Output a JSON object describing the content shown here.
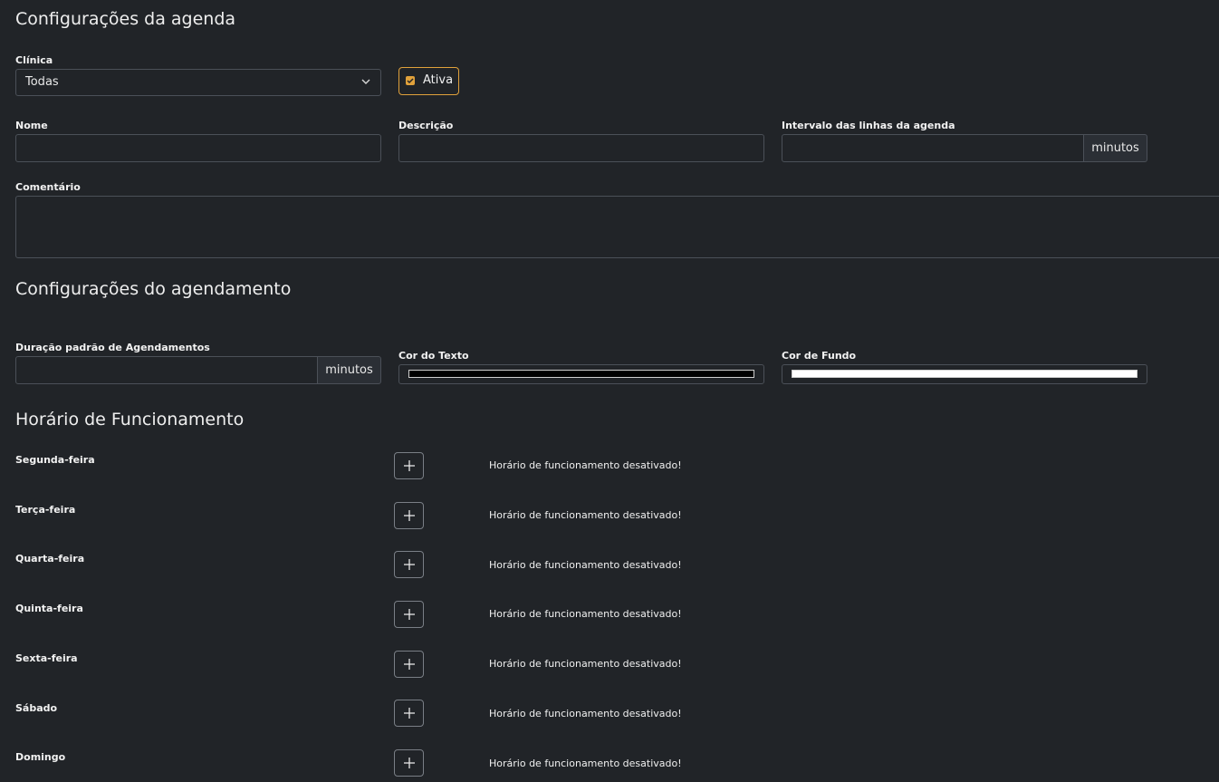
{
  "agenda": {
    "title": "Configurações da agenda",
    "clinic_label": "Clínica",
    "clinic_value": "Todas",
    "active_label": "Ativa",
    "name_label": "Nome",
    "name_value": "",
    "description_label": "Descrição",
    "description_value": "",
    "interval_label": "Intervalo das linhas da agenda",
    "interval_value": "",
    "interval_unit": "minutos",
    "comment_label": "Comentário",
    "comment_value": ""
  },
  "scheduling": {
    "title": "Configurações do agendamento",
    "duration_label": "Duração padrão de Agendamentos",
    "duration_value": "",
    "duration_unit": "minutos",
    "text_color_label": "Cor do Texto",
    "text_color": "#000000",
    "bg_color_label": "Cor de Fundo",
    "bg_color": "#ffffff"
  },
  "hours": {
    "title": "Horário de Funcionamento",
    "days": [
      {
        "label": "Segunda-feira",
        "status": "Horário de funcionamento desativado!"
      },
      {
        "label": "Terça-feira",
        "status": "Horário de funcionamento desativado!"
      },
      {
        "label": "Quarta-feira",
        "status": "Horário de funcionamento desativado!"
      },
      {
        "label": "Quinta-feira",
        "status": "Horário de funcionamento desativado!"
      },
      {
        "label": "Sexta-feira",
        "status": "Horário de funcionamento desativado!"
      },
      {
        "label": "Sábado",
        "status": "Horário de funcionamento desativado!"
      },
      {
        "label": "Domingo",
        "status": "Horário de funcionamento desativado!"
      }
    ]
  },
  "colors": {
    "accent": "#e0a13b",
    "background": "#212428",
    "border": "#4b5058"
  }
}
